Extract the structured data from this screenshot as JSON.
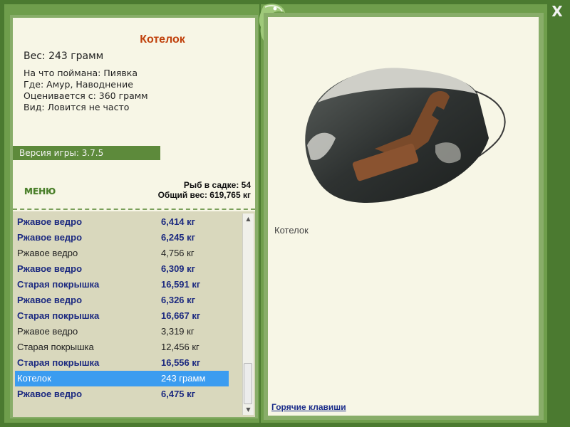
{
  "window": {
    "close_label": "X"
  },
  "info": {
    "title": "Котелок",
    "weight": "Вес: 243 грамм",
    "lines": [
      "На что поймана: Пиявка",
      "Где: Амур, Наводнение",
      "Оценивается с: 360 грамм",
      "Вид: Ловится не часто"
    ],
    "version": "Версия игры: 3.7.5"
  },
  "menu": {
    "label": "МЕНЮ"
  },
  "stats": {
    "fish_count": "Рыб в садке: 54",
    "total_weight": "Общий вес: 619,765 кг"
  },
  "list": {
    "rows": [
      {
        "name": "Ржавое ведро",
        "weight": "6,414 кг",
        "bold": true
      },
      {
        "name": "Ржавое ведро",
        "weight": "6,245 кг",
        "bold": true
      },
      {
        "name": "Ржавое ведро",
        "weight": "4,756 кг",
        "bold": false
      },
      {
        "name": "Ржавое ведро",
        "weight": "6,309 кг",
        "bold": true
      },
      {
        "name": "Старая покрышка",
        "weight": "16,591 кг",
        "bold": true
      },
      {
        "name": "Ржавое ведро",
        "weight": "6,326 кг",
        "bold": true
      },
      {
        "name": "Старая покрышка",
        "weight": "16,667 кг",
        "bold": true
      },
      {
        "name": "Ржавое ведро",
        "weight": "3,319 кг",
        "bold": false
      },
      {
        "name": "Старая покрышка",
        "weight": "12,456 кг",
        "bold": false
      },
      {
        "name": "Старая покрышка",
        "weight": "16,556 кг",
        "bold": true
      },
      {
        "name": "Котелок",
        "weight": "243 грамм",
        "bold": false,
        "selected": true
      },
      {
        "name": "Ржавое ведро",
        "weight": "6,475 кг",
        "bold": true
      }
    ],
    "scroll_up": "▲",
    "scroll_down": "▼"
  },
  "detail": {
    "caption": "Котелок",
    "hotkeys": "Горячие клавиши"
  },
  "colors": {
    "frame": "#4b7a30",
    "panel": "#f7f6e6",
    "list_bg": "#d9d8bd",
    "title": "#c0410c",
    "bold_text": "#1c2a80",
    "selection": "#3b9cf0"
  }
}
